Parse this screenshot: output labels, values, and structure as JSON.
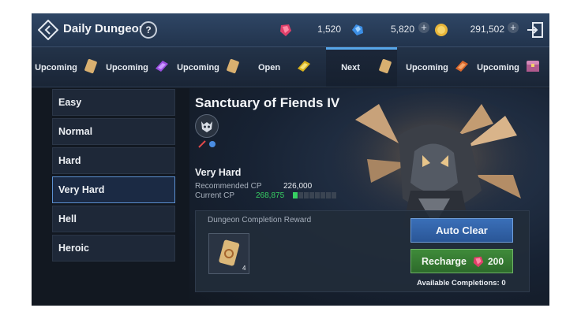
{
  "header": {
    "title": "Daily Dungeon",
    "help_label": "?",
    "currencies": [
      {
        "name": "red-gem",
        "value": "1,520"
      },
      {
        "name": "blue-gem",
        "value": "5,820"
      },
      {
        "name": "gold-coin",
        "value": "291,502"
      }
    ],
    "plus_label": "+"
  },
  "tabs": [
    {
      "label": "Upcoming",
      "icon": "scroll-icon"
    },
    {
      "label": "Upcoming",
      "icon": "purple-crystal-icon"
    },
    {
      "label": "Upcoming",
      "icon": "scroll-icon"
    },
    {
      "label": "Open",
      "icon": "gold-crystal-icon"
    },
    {
      "label": "Next",
      "icon": "scroll-icon"
    },
    {
      "label": "Upcoming",
      "icon": "orange-crystal-icon"
    },
    {
      "label": "Upcoming",
      "icon": "chest-icon"
    }
  ],
  "active_tab": 4,
  "difficulties": [
    "Easy",
    "Normal",
    "Hard",
    "Very Hard",
    "Hell",
    "Heroic"
  ],
  "selected_difficulty": 3,
  "dungeon": {
    "name": "Sanctuary of Fiends IV",
    "level": "Very Hard",
    "recommended_cp_label": "Recommended CP",
    "recommended_cp": "226,000",
    "current_cp_label": "Current CP",
    "current_cp": "268,875",
    "cp_meter_fraction": 0.125
  },
  "reward": {
    "title": "Dungeon Completion Reward",
    "count": "4"
  },
  "buttons": {
    "auto_clear": "Auto Clear",
    "recharge": "Recharge",
    "recharge_cost": "200"
  },
  "available_completions": "Available Completions: 0",
  "colors": {
    "accent_blue": "#57a7ea",
    "cp_good": "#38d063"
  }
}
